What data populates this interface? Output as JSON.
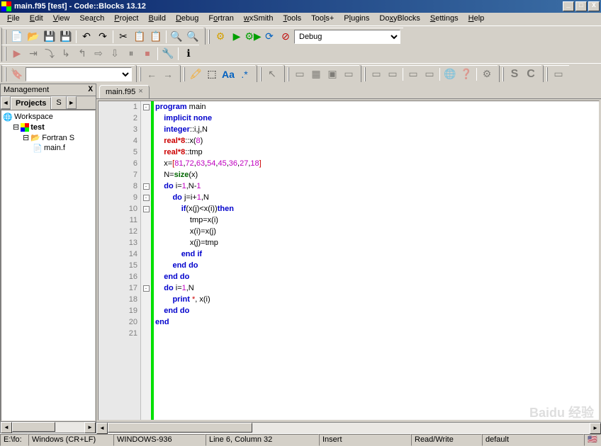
{
  "window": {
    "title": "main.f95 [test] - Code::Blocks 13.12"
  },
  "menu": {
    "items": [
      "File",
      "Edit",
      "View",
      "Search",
      "Project",
      "Build",
      "Debug",
      "Fortran",
      "wxSmith",
      "Tools",
      "Tools+",
      "Plugins",
      "DoxyBlocks",
      "Settings",
      "Help"
    ]
  },
  "build_target": "Debug",
  "management": {
    "title": "Management",
    "tabs": [
      "Projects",
      "S"
    ],
    "tree": {
      "workspace": "Workspace",
      "project": "test",
      "folder": "Fortran S",
      "file": "main.f"
    }
  },
  "file_tab": {
    "name": "main.f95"
  },
  "code": {
    "lines": [
      {
        "n": "1",
        "fold": "[-]",
        "tokens": [
          [
            "kw",
            "program"
          ],
          [
            "",
            " main"
          ]
        ]
      },
      {
        "n": "2",
        "fold": "",
        "tokens": [
          [
            "",
            "    "
          ],
          [
            "kw",
            "implicit"
          ],
          [
            "",
            " "
          ],
          [
            "kw",
            "none"
          ]
        ]
      },
      {
        "n": "3",
        "fold": "",
        "tokens": [
          [
            "",
            "    "
          ],
          [
            "kw",
            "integer"
          ],
          [
            "",
            "::i,j,N"
          ]
        ]
      },
      {
        "n": "4",
        "fold": "",
        "tokens": [
          [
            "",
            "    "
          ],
          [
            "type-red",
            "real*8"
          ],
          [
            "",
            "::x("
          ],
          [
            "num",
            "8"
          ],
          [
            "",
            ")"
          ]
        ]
      },
      {
        "n": "5",
        "fold": "",
        "tokens": [
          [
            "",
            "    "
          ],
          [
            "type-red",
            "real*8"
          ],
          [
            "",
            "::tmp"
          ]
        ]
      },
      {
        "n": "6",
        "fold": "",
        "tokens": [
          [
            "",
            "    x="
          ],
          [
            "op-red",
            "["
          ],
          [
            "num",
            "81"
          ],
          [
            "",
            ","
          ],
          [
            "num",
            "72"
          ],
          [
            "",
            ","
          ],
          [
            "num",
            "63"
          ],
          [
            "",
            ","
          ],
          [
            "num",
            "54"
          ],
          [
            "",
            ","
          ],
          [
            "num",
            "45"
          ],
          [
            "",
            ","
          ],
          [
            "num",
            "36"
          ],
          [
            "",
            ","
          ],
          [
            "num",
            "27"
          ],
          [
            "",
            ","
          ],
          [
            "num",
            "18"
          ],
          [
            "op-red",
            "]"
          ]
        ]
      },
      {
        "n": "7",
        "fold": "",
        "tokens": [
          [
            "",
            "    N="
          ],
          [
            "func",
            "size"
          ],
          [
            "",
            "(x)"
          ]
        ]
      },
      {
        "n": "8",
        "fold": "[-]",
        "tokens": [
          [
            "",
            "    "
          ],
          [
            "kw",
            "do"
          ],
          [
            "",
            " i="
          ],
          [
            "num",
            "1"
          ],
          [
            "",
            ",N-"
          ],
          [
            "num",
            "1"
          ]
        ]
      },
      {
        "n": "9",
        "fold": "[-]",
        "tokens": [
          [
            "",
            "        "
          ],
          [
            "kw",
            "do"
          ],
          [
            "",
            " j=i+"
          ],
          [
            "num",
            "1"
          ],
          [
            "",
            ",N"
          ]
        ]
      },
      {
        "n": "10",
        "fold": "[-]",
        "tokens": [
          [
            "",
            "            "
          ],
          [
            "kw",
            "if"
          ],
          [
            "",
            "(x(j)<x(i))"
          ],
          [
            "kw",
            "then"
          ]
        ]
      },
      {
        "n": "11",
        "fold": "",
        "tokens": [
          [
            "",
            "                tmp=x(i)"
          ]
        ]
      },
      {
        "n": "12",
        "fold": "",
        "tokens": [
          [
            "",
            "                x(i)=x(j)"
          ]
        ]
      },
      {
        "n": "13",
        "fold": "",
        "tokens": [
          [
            "",
            "                x(j)=tmp"
          ]
        ]
      },
      {
        "n": "14",
        "fold": "",
        "tokens": [
          [
            "",
            "            "
          ],
          [
            "kw",
            "end"
          ],
          [
            "",
            " "
          ],
          [
            "kw",
            "if"
          ]
        ]
      },
      {
        "n": "15",
        "fold": "",
        "tokens": [
          [
            "",
            "        "
          ],
          [
            "kw",
            "end"
          ],
          [
            "",
            " "
          ],
          [
            "kw",
            "do"
          ]
        ]
      },
      {
        "n": "16",
        "fold": "",
        "tokens": [
          [
            "",
            "    "
          ],
          [
            "kw",
            "end"
          ],
          [
            "",
            " "
          ],
          [
            "kw",
            "do"
          ]
        ]
      },
      {
        "n": "17",
        "fold": "[-]",
        "tokens": [
          [
            "",
            "    "
          ],
          [
            "kw",
            "do"
          ],
          [
            "",
            " i="
          ],
          [
            "num",
            "1"
          ],
          [
            "",
            ",N"
          ]
        ]
      },
      {
        "n": "18",
        "fold": "",
        "tokens": [
          [
            "",
            "        "
          ],
          [
            "kw",
            "print"
          ],
          [
            "",
            " "
          ],
          [
            "op-red",
            "*"
          ],
          [
            "",
            ", x(i)"
          ]
        ]
      },
      {
        "n": "19",
        "fold": "",
        "tokens": [
          [
            "",
            "    "
          ],
          [
            "kw",
            "end"
          ],
          [
            "",
            " "
          ],
          [
            "kw",
            "do"
          ]
        ]
      },
      {
        "n": "20",
        "fold": "",
        "tokens": [
          [
            "kw",
            "end"
          ]
        ]
      },
      {
        "n": "21",
        "fold": "",
        "tokens": [
          [
            "",
            ""
          ]
        ]
      }
    ]
  },
  "status": {
    "path": "E:\\fo:",
    "eol": "Windows (CR+LF)",
    "encoding": "WINDOWS-936",
    "position": "Line 6, Column 32",
    "mode": "Insert",
    "rw": "Read/Write",
    "profile": "default"
  },
  "watermark": "Baidu 经验"
}
